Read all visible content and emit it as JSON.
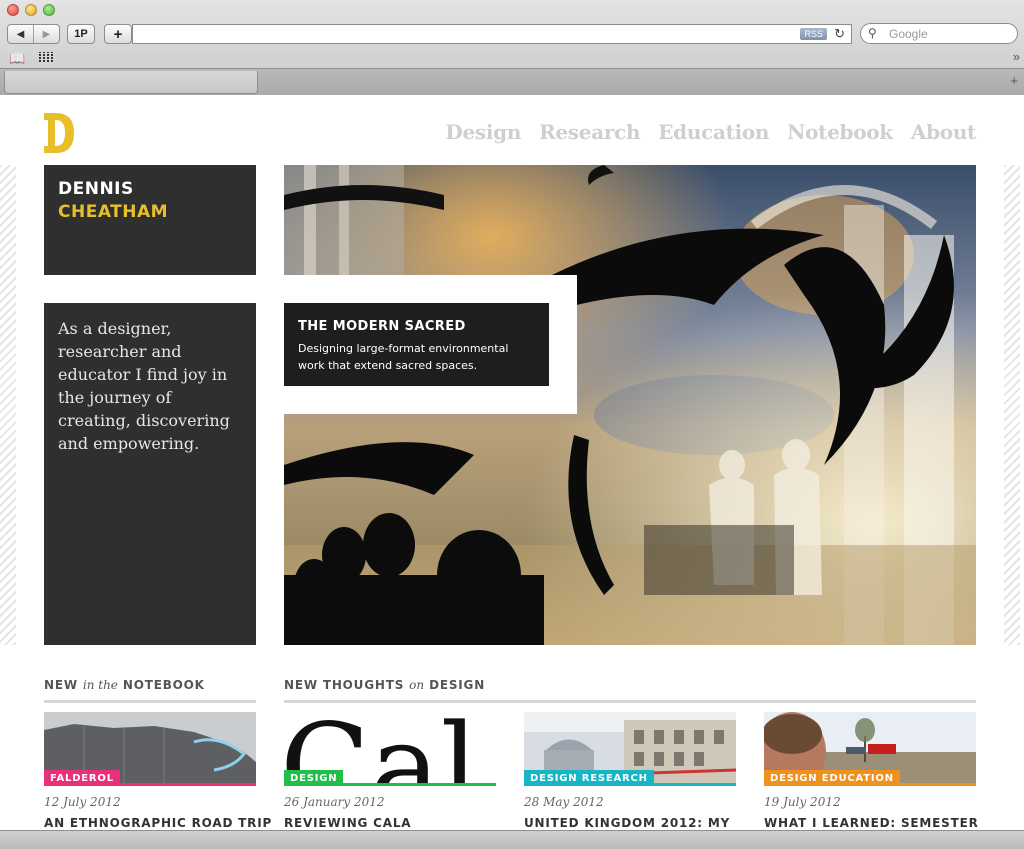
{
  "browser": {
    "back_icon": "◀",
    "forward_icon": "▶",
    "onepassword_label": "1P",
    "add_label": "+",
    "rss_label": "RSS",
    "reload_icon": "↻",
    "search_placeholder": "Google",
    "more_icon": "»",
    "new_tab_icon": "+"
  },
  "site": {
    "logo_alt": "D",
    "nav": [
      "Design",
      "Research",
      "Education",
      "Notebook",
      "About"
    ],
    "name_first": "DENNIS",
    "name_last": "CHEATHAM",
    "intro": "As a designer, researcher and educator I find joy in the journey of creating, discovering and empowering.",
    "accent": "#e8bf2b"
  },
  "feature": {
    "title": "THE MODERN SACRED",
    "description": "Designing large-format environmental work that extend sacred spaces."
  },
  "notebook": {
    "heading_pre": "NEW",
    "heading_em": "in the",
    "heading_post": "NOTEBOOK",
    "item": {
      "tag": "FALDEROL",
      "tag_color": "#e8317a",
      "date": "12 July 2012",
      "title": "AN ETHNOGRAPHIC ROAD TRIP"
    }
  },
  "design": {
    "heading_pre": "NEW THOUGHTS",
    "heading_em": "on",
    "heading_post": "DESIGN",
    "items": [
      {
        "tag": "DESIGN",
        "tag_color": "#1fbf4a",
        "date": "26 January 2012",
        "title": "REVIEWING CALA"
      },
      {
        "tag": "DESIGN RESEARCH",
        "tag_color": "#17b6c7",
        "date": "28 May 2012",
        "title": "UNITED KINGDOM 2012: MY"
      },
      {
        "tag": "DESIGN EDUCATION",
        "tag_color": "#f0901e",
        "date": "19 July 2012",
        "title": "WHAT I LEARNED: SEMESTER"
      }
    ]
  }
}
